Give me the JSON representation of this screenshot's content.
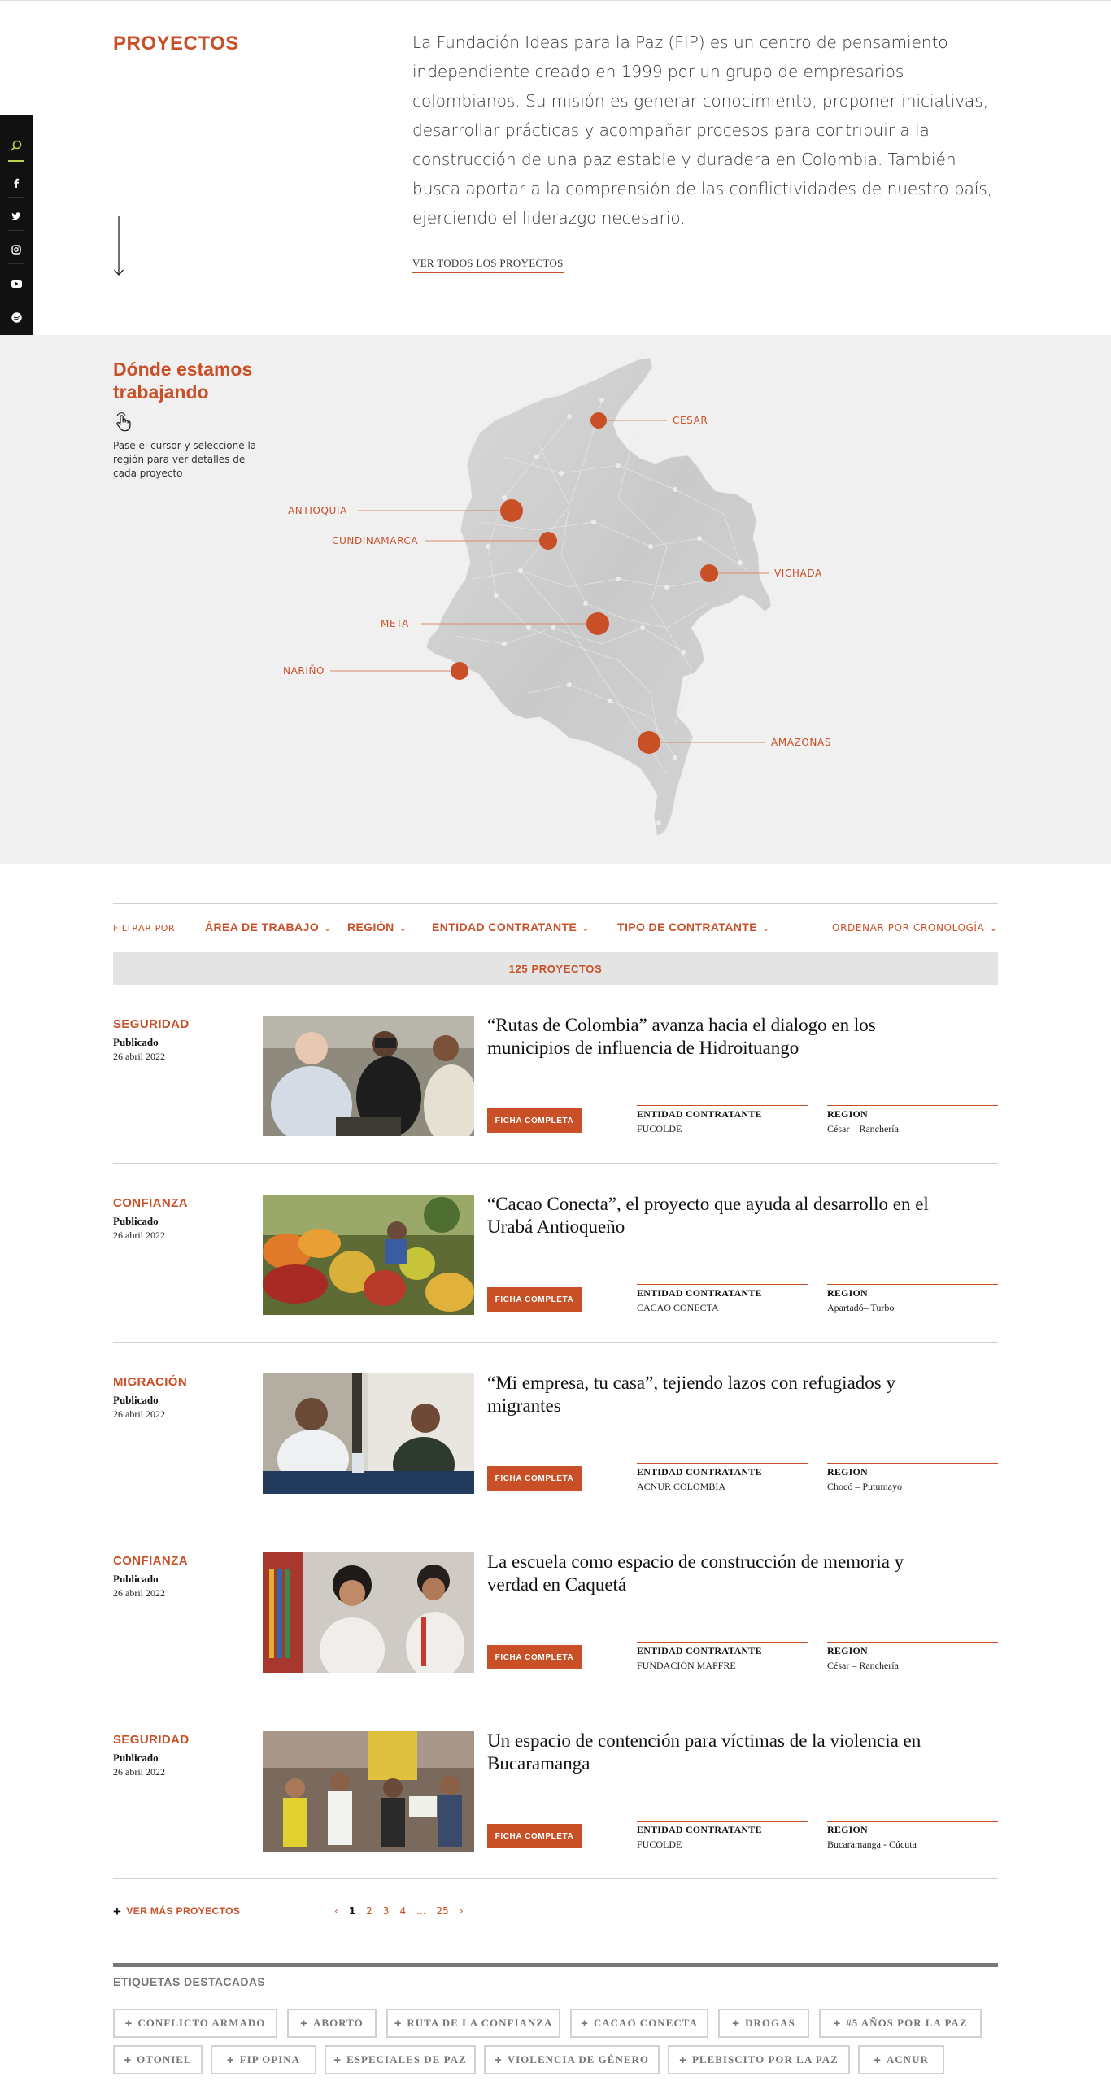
{
  "intro": {
    "title": "PROYECTOS",
    "text": "La Fundación Ideas para la Paz (FIP) es un centro de pensamiento independiente creado en 1999 por un grupo de empresarios colombianos. Su misión es generar conocimiento, proponer iniciativas, desarrollar prácticas y acompañar procesos para contribuir a la construcción de una paz estable y duradera en Colombia. También busca aportar a la comprensión de las conflictividades de nuestro país, ejerciendo el liderazgo necesario.",
    "link": "VER TODOS LOS PROYECTOS"
  },
  "social": [
    "search-icon",
    "facebook-icon",
    "twitter-icon",
    "instagram-icon",
    "youtube-icon",
    "spotify-icon"
  ],
  "map": {
    "title": "Dónde estamos trabajando",
    "hint": "Pase el cursor y seleccione la región para ver detalles de cada proyecto",
    "regions": [
      "CESAR",
      "ANTIOQUIA",
      "CUNDINAMARCA",
      "VICHADA",
      "META",
      "NARIÑO",
      "AMAZONAS"
    ]
  },
  "filters": {
    "label": "FILTRAR POR",
    "items": [
      "ÁREA DE TRABAJO",
      "REGIÓN",
      "ENTIDAD CONTRATANTE",
      "TIPO DE CONTRATANTE"
    ],
    "order": "ORDENAR POR CRONOLOGÍA",
    "count": "125 PROYECTOS"
  },
  "projects": [
    {
      "category": "SEGURIDAD",
      "published_label": "Publicado",
      "date": "26 abril 2022",
      "title": "“Rutas de Colombia” avanza hacia el dialogo en los municipios de influencia de Hidroituango",
      "button": "FICHA COMPLETA",
      "entity_label": "ENTIDAD CONTRATANTE",
      "entity": "FUCOLDE",
      "region_label": "REGION",
      "region": "César – Ranchería"
    },
    {
      "category": "CONFIANZA",
      "published_label": "Publicado",
      "date": "26 abril 2022",
      "title": "“Cacao Conecta”, el proyecto que ayuda al desarrollo en el Urabá Antioqueño",
      "button": "FICHA COMPLETA",
      "entity_label": "ENTIDAD CONTRATANTE",
      "entity": "CACAO CONECTA",
      "region_label": "REGION",
      "region": "Apartadó– Turbo"
    },
    {
      "category": "MIGRACIÓN",
      "published_label": "Publicado",
      "date": "26 abril 2022",
      "title": "“Mi empresa, tu casa”, tejiendo lazos con refugiados y migrantes",
      "button": "FICHA COMPLETA",
      "entity_label": "ENTIDAD CONTRATANTE",
      "entity": "ACNUR COLOMBIA",
      "region_label": "REGION",
      "region": "Chocó – Putumayo"
    },
    {
      "category": "CONFIANZA",
      "published_label": "Publicado",
      "date": "26 abril 2022",
      "title": "La escuela como espacio de construcción de memoria y verdad en Caquetá",
      "button": "FICHA COMPLETA",
      "entity_label": "ENTIDAD CONTRATANTE",
      "entity": "FUNDACIÓN MAPFRE",
      "region_label": "REGION",
      "region": "César – Ranchería"
    },
    {
      "category": "SEGURIDAD",
      "published_label": "Publicado",
      "date": "26 abril 2022",
      "title": "Un espacio de contención para víctimas de la violencia en Bucaramanga",
      "button": "FICHA COMPLETA",
      "entity_label": "ENTIDAD CONTRATANTE",
      "entity": "FUCOLDE",
      "region_label": "REGION",
      "region": "Bucaramanga - Cúcuta"
    }
  ],
  "pagination": {
    "more": "VER MÁS PROYECTOS",
    "prev": "‹",
    "pages": [
      "1",
      "2",
      "3",
      "4",
      "...",
      "25"
    ],
    "next": "›"
  },
  "tags": {
    "title": "ETIQUETAS DESTACADAS",
    "items": [
      "CONFLICTO ARMADO",
      "ABORTO",
      "RUTA DE LA CONFIANZA",
      "CACAO CONECTA",
      "DROGAS",
      "#5 AÑOS POR LA PAZ",
      "OTONIEL",
      "FIP OPINA",
      "ESPECIALES DE PAZ",
      "VIOLENCIA DE GÉNERO",
      "PLEBISCITO POR LA PAZ",
      "ACNUR"
    ]
  },
  "colors": {
    "accent": "#c94f27",
    "map_bg": "#f0f0f0",
    "sidebar": "#111111",
    "search_accent": "#bcd04c"
  }
}
